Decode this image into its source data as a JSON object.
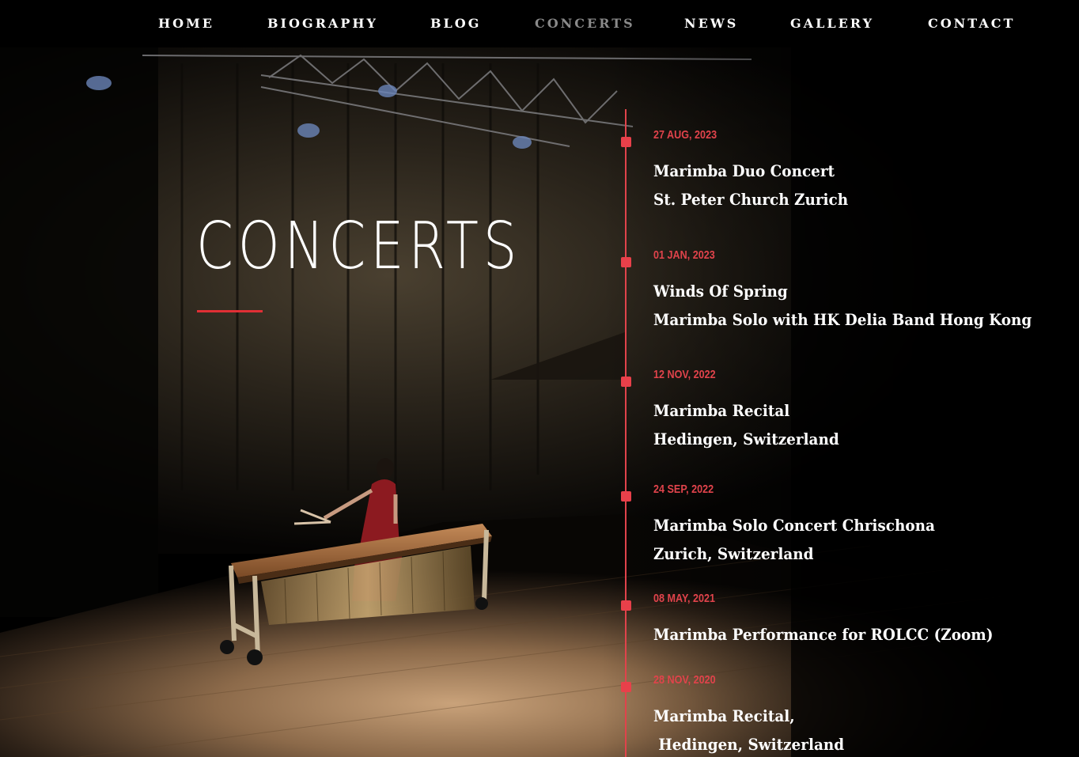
{
  "nav": {
    "items": [
      {
        "label": "HOME"
      },
      {
        "label": "BIOGRAPHY"
      },
      {
        "label": "BLOG"
      },
      {
        "label": "CONCERTS"
      },
      {
        "label": "NEWS"
      },
      {
        "label": "GALLERY"
      },
      {
        "label": "CONTACT"
      }
    ],
    "active": "CONCERTS"
  },
  "hero": {
    "title": "CONCERTS"
  },
  "concerts": [
    {
      "date": "27 AUG, 2023",
      "line1": "Marimba Duo Concert",
      "line2": "St. Peter Church Zurich"
    },
    {
      "date": "01 JAN, 2023",
      "line1": "Winds Of Spring",
      "line2": "Marimba Solo with HK Delia Band Hong Kong"
    },
    {
      "date": "12 NOV, 2022",
      "line1": "Marimba Recital",
      "line2": "Hedingen,  Switzerland"
    },
    {
      "date": "24 SEP, 2022",
      "line1": "Marimba Solo Concert Chrischona",
      "line2": "Zurich, Switzerland"
    },
    {
      "date": "08 MAY, 2021",
      "line1": "Marimba Performance for ROLCC  (Zoom)",
      "line2": ""
    },
    {
      "date": "28 NOV, 2020",
      "line1": "Marimba Recital,",
      "line2": " Hedingen, Switzerland"
    }
  ],
  "colors": {
    "accent": "#e0434b",
    "nav_active": "#8a8a8a",
    "text": "#ffffff",
    "background": "#000000"
  }
}
